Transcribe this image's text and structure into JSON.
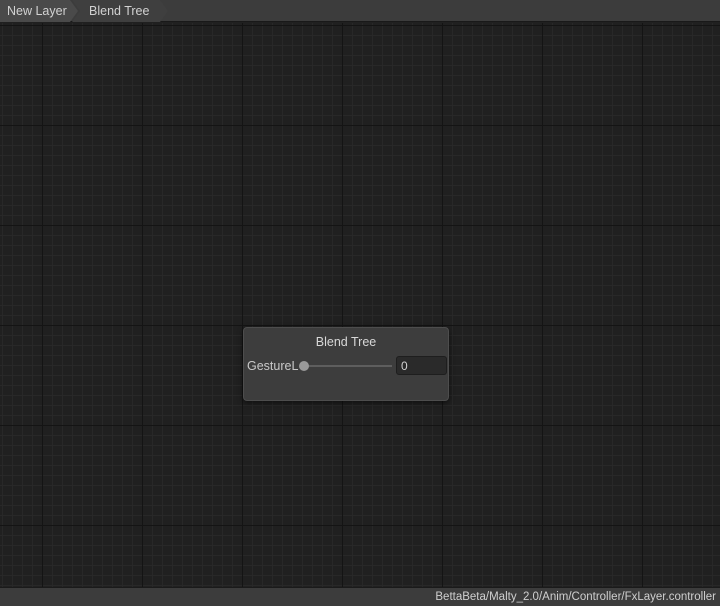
{
  "breadcrumb": {
    "items": [
      {
        "label": "New Layer"
      },
      {
        "label": "Blend Tree"
      }
    ]
  },
  "node": {
    "title": "Blend Tree",
    "parameter": {
      "name": "GestureL",
      "value": "0",
      "slider_fraction": 0
    }
  },
  "status_bar": {
    "path": "BettaBeta/Malty_2.0/Anim/Controller/FxLayer.controller"
  },
  "colors": {
    "background": "#202020",
    "node": "#3d3d3d",
    "toolbar": "#3c3c3c"
  }
}
